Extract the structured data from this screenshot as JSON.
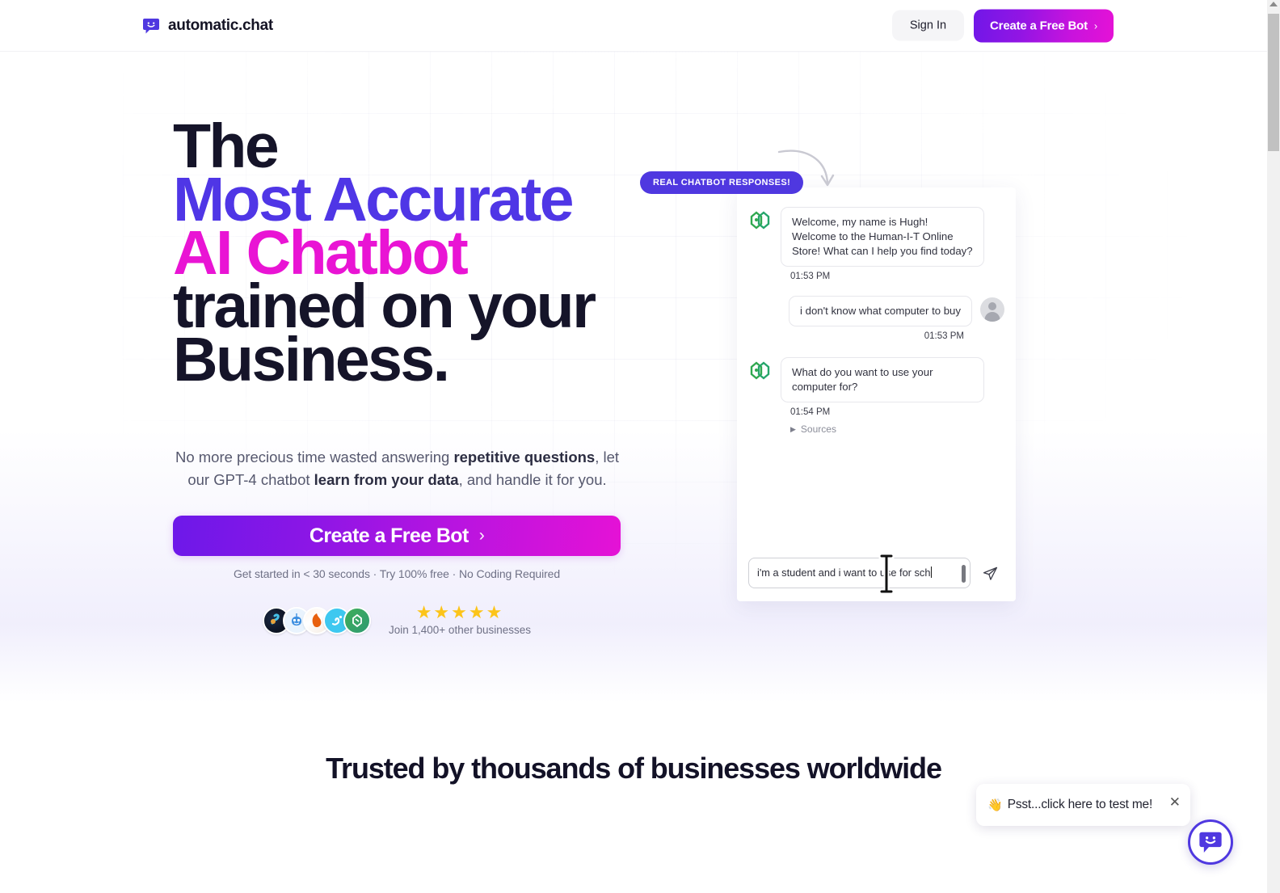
{
  "header": {
    "brand_name": "automatic.chat",
    "brand_icon": "chat-smile-icon",
    "signin_label": "Sign In",
    "cta_label": "Create a Free Bot",
    "cta_chevron": "›"
  },
  "hero": {
    "headline": {
      "line1": "The",
      "line2": "Most Accurate",
      "line3": "AI Chatbot",
      "line4": "trained on your",
      "line5": "Business."
    },
    "subhead": {
      "part1": "No more precious time wasted answering ",
      "bold1": "repetitive questions",
      "part2": ", let our GPT-4 chatbot ",
      "bold2": "learn from your data",
      "part3": ", and handle it for you."
    },
    "cta_label": "Create a Free Bot",
    "cta_chevron": "›",
    "cta_note": "Get started in < 30 seconds · Try 100% free · No Coding Required",
    "stars": "★★★★★",
    "join_text": "Join 1,400+ other businesses"
  },
  "chat_demo": {
    "badge": "REAL CHATBOT RESPONSES!",
    "messages": [
      {
        "sender": "bot",
        "text": "Welcome, my name is Hugh! Welcome to the Human-I-T Online Store! What can I help you find today?",
        "time": "01:53 PM"
      },
      {
        "sender": "user",
        "text": "i don't know what computer to buy",
        "time": "01:53 PM"
      },
      {
        "sender": "bot",
        "text": "What do you want to use your computer for?",
        "time": "01:54 PM"
      }
    ],
    "sources_label": "Sources",
    "input_value_line1": "i'm a student and i want to use for",
    "input_value_line2": "sch",
    "send_icon": "paper-plane-icon"
  },
  "trusted": {
    "heading": "Trusted by thousands of businesses worldwide"
  },
  "widget": {
    "psst_hand": "👋",
    "psst_text": "Psst...click here to test me!",
    "close_icon": "close-icon",
    "launcher_icon": "chat-smile-icon"
  },
  "colors": {
    "accent_purple": "#4f36e6",
    "accent_pink": "#e914d4",
    "brand_indigo": "#4f38e0",
    "star_yellow": "#fcc419",
    "ink": "#151429"
  }
}
